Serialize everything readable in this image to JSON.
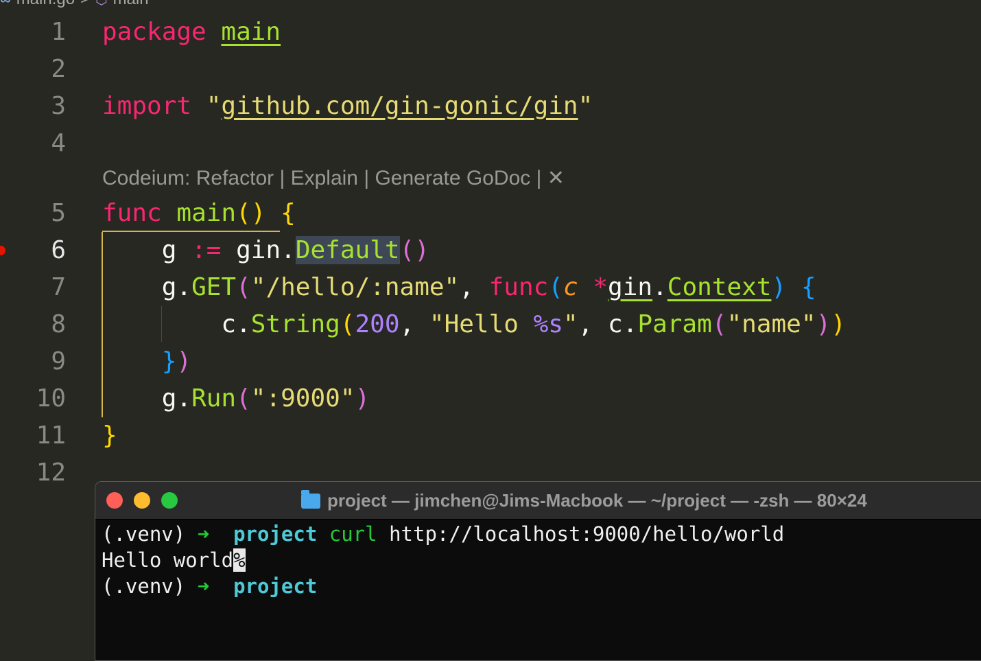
{
  "breadcrumb": {
    "file": "main.go",
    "separator": ">",
    "symbol": "main",
    "file_icon": "go-file-icon",
    "symbol_icon": "cube-symbol-icon"
  },
  "editor": {
    "line_numbers": [
      "1",
      "2",
      "3",
      "4",
      "5",
      "6",
      "7",
      "8",
      "9",
      "10",
      "11",
      "12"
    ],
    "active_line": "6",
    "breakpoint_line": "6",
    "codelens": {
      "prefix": "Codeium: ",
      "refactor": "Refactor",
      "sep": " | ",
      "explain": "Explain",
      "godoc": "Generate GoDoc",
      "close": "✕"
    },
    "code": {
      "l1_kw": "package",
      "l1_name": "main",
      "l3_kw": "import",
      "l3_q1": "\"",
      "l3_path": "github.com/gin-gonic/gin",
      "l3_q2": "\"",
      "l5_kw": "func",
      "l5_name": "main",
      "l5_paren": "()",
      "l5_brace": "{",
      "l6_var": "g",
      "l6_op": ":=",
      "l6_pkg": "gin.",
      "l6_fn": "Default",
      "l6_paren": "()",
      "l7_recv": "g.",
      "l7_fn": "GET",
      "l7_open": "(",
      "l7_str": "\"/hello/:name\"",
      "l7_comma": ",",
      "l7_kw": "func",
      "l7_popen": "(",
      "l7_param": "c",
      "l7_star": "*",
      "l7_pkg": "gin",
      "l7_dot": ".",
      "l7_type": "Context",
      "l7_pclose": ")",
      "l7_brace": "{",
      "l8_recv": "c.",
      "l8_fn": "String",
      "l8_open": "(",
      "l8_num": "200",
      "l8_comma": ",",
      "l8_str1": "\"Hello ",
      "l8_fmt": "%s",
      "l8_str2": "\"",
      "l8_comma2": ",",
      "l8_recv2": "c.",
      "l8_fn2": "Param",
      "l8_open2": "(",
      "l8_str3": "\"name\"",
      "l8_close2": ")",
      "l8_close": ")",
      "l9_brace": "}",
      "l9_paren": ")",
      "l10_recv": "g.",
      "l10_fn": "Run",
      "l10_open": "(",
      "l10_str": "\":9000\"",
      "l10_close": ")",
      "l11_brace": "}"
    }
  },
  "terminal": {
    "title": "project — jimchen@Jims-Macbook — ~/project — -zsh — 80×24",
    "folder_icon": "folder-icon",
    "lines": [
      {
        "venv": "(.venv)",
        "arrow": "➜",
        "dir": "project",
        "cmd": "curl",
        "args": "http://localhost:9000/hello/world"
      },
      {
        "output": "Hello world",
        "marker": "%"
      },
      {
        "venv": "(.venv)",
        "arrow": "➜",
        "dir": "project"
      }
    ]
  },
  "colors": {
    "editor_bg": "#272822",
    "keyword": "#f92672",
    "function": "#a6e22e",
    "string": "#e6db74",
    "number": "#ae81ff",
    "breakpoint": "#e51400",
    "terminal_bg": "#0c0c0c",
    "prompt_arrow": "#26c93a",
    "prompt_dir": "#4ec9d6"
  }
}
